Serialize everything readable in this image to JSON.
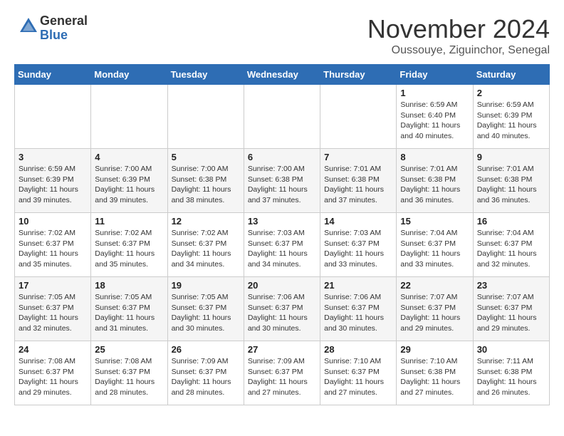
{
  "logo": {
    "line1": "General",
    "line2": "Blue"
  },
  "title": "November 2024",
  "subtitle": "Oussouye, Ziguinchor, Senegal",
  "days_of_week": [
    "Sunday",
    "Monday",
    "Tuesday",
    "Wednesday",
    "Thursday",
    "Friday",
    "Saturday"
  ],
  "weeks": [
    [
      {
        "day": "",
        "info": ""
      },
      {
        "day": "",
        "info": ""
      },
      {
        "day": "",
        "info": ""
      },
      {
        "day": "",
        "info": ""
      },
      {
        "day": "",
        "info": ""
      },
      {
        "day": "1",
        "info": "Sunrise: 6:59 AM\nSunset: 6:40 PM\nDaylight: 11 hours and 40 minutes."
      },
      {
        "day": "2",
        "info": "Sunrise: 6:59 AM\nSunset: 6:39 PM\nDaylight: 11 hours and 40 minutes."
      }
    ],
    [
      {
        "day": "3",
        "info": "Sunrise: 6:59 AM\nSunset: 6:39 PM\nDaylight: 11 hours and 39 minutes."
      },
      {
        "day": "4",
        "info": "Sunrise: 7:00 AM\nSunset: 6:39 PM\nDaylight: 11 hours and 39 minutes."
      },
      {
        "day": "5",
        "info": "Sunrise: 7:00 AM\nSunset: 6:38 PM\nDaylight: 11 hours and 38 minutes."
      },
      {
        "day": "6",
        "info": "Sunrise: 7:00 AM\nSunset: 6:38 PM\nDaylight: 11 hours and 37 minutes."
      },
      {
        "day": "7",
        "info": "Sunrise: 7:01 AM\nSunset: 6:38 PM\nDaylight: 11 hours and 37 minutes."
      },
      {
        "day": "8",
        "info": "Sunrise: 7:01 AM\nSunset: 6:38 PM\nDaylight: 11 hours and 36 minutes."
      },
      {
        "day": "9",
        "info": "Sunrise: 7:01 AM\nSunset: 6:38 PM\nDaylight: 11 hours and 36 minutes."
      }
    ],
    [
      {
        "day": "10",
        "info": "Sunrise: 7:02 AM\nSunset: 6:37 PM\nDaylight: 11 hours and 35 minutes."
      },
      {
        "day": "11",
        "info": "Sunrise: 7:02 AM\nSunset: 6:37 PM\nDaylight: 11 hours and 35 minutes."
      },
      {
        "day": "12",
        "info": "Sunrise: 7:02 AM\nSunset: 6:37 PM\nDaylight: 11 hours and 34 minutes."
      },
      {
        "day": "13",
        "info": "Sunrise: 7:03 AM\nSunset: 6:37 PM\nDaylight: 11 hours and 34 minutes."
      },
      {
        "day": "14",
        "info": "Sunrise: 7:03 AM\nSunset: 6:37 PM\nDaylight: 11 hours and 33 minutes."
      },
      {
        "day": "15",
        "info": "Sunrise: 7:04 AM\nSunset: 6:37 PM\nDaylight: 11 hours and 33 minutes."
      },
      {
        "day": "16",
        "info": "Sunrise: 7:04 AM\nSunset: 6:37 PM\nDaylight: 11 hours and 32 minutes."
      }
    ],
    [
      {
        "day": "17",
        "info": "Sunrise: 7:05 AM\nSunset: 6:37 PM\nDaylight: 11 hours and 32 minutes."
      },
      {
        "day": "18",
        "info": "Sunrise: 7:05 AM\nSunset: 6:37 PM\nDaylight: 11 hours and 31 minutes."
      },
      {
        "day": "19",
        "info": "Sunrise: 7:05 AM\nSunset: 6:37 PM\nDaylight: 11 hours and 30 minutes."
      },
      {
        "day": "20",
        "info": "Sunrise: 7:06 AM\nSunset: 6:37 PM\nDaylight: 11 hours and 30 minutes."
      },
      {
        "day": "21",
        "info": "Sunrise: 7:06 AM\nSunset: 6:37 PM\nDaylight: 11 hours and 30 minutes."
      },
      {
        "day": "22",
        "info": "Sunrise: 7:07 AM\nSunset: 6:37 PM\nDaylight: 11 hours and 29 minutes."
      },
      {
        "day": "23",
        "info": "Sunrise: 7:07 AM\nSunset: 6:37 PM\nDaylight: 11 hours and 29 minutes."
      }
    ],
    [
      {
        "day": "24",
        "info": "Sunrise: 7:08 AM\nSunset: 6:37 PM\nDaylight: 11 hours and 29 minutes."
      },
      {
        "day": "25",
        "info": "Sunrise: 7:08 AM\nSunset: 6:37 PM\nDaylight: 11 hours and 28 minutes."
      },
      {
        "day": "26",
        "info": "Sunrise: 7:09 AM\nSunset: 6:37 PM\nDaylight: 11 hours and 28 minutes."
      },
      {
        "day": "27",
        "info": "Sunrise: 7:09 AM\nSunset: 6:37 PM\nDaylight: 11 hours and 27 minutes."
      },
      {
        "day": "28",
        "info": "Sunrise: 7:10 AM\nSunset: 6:37 PM\nDaylight: 11 hours and 27 minutes."
      },
      {
        "day": "29",
        "info": "Sunrise: 7:10 AM\nSunset: 6:38 PM\nDaylight: 11 hours and 27 minutes."
      },
      {
        "day": "30",
        "info": "Sunrise: 7:11 AM\nSunset: 6:38 PM\nDaylight: 11 hours and 26 minutes."
      }
    ]
  ]
}
